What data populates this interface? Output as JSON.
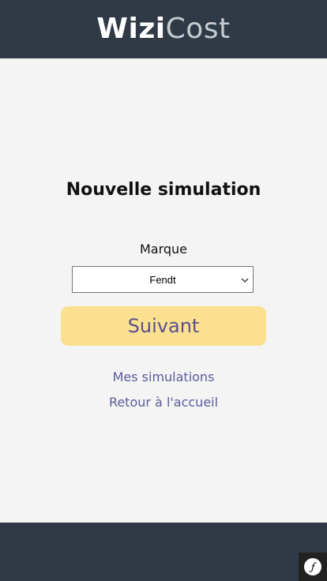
{
  "header": {
    "logo_part1": "Wizi",
    "logo_part2": "Cost"
  },
  "form": {
    "title": "Nouvelle simulation",
    "brand_label": "Marque",
    "brand_selected": "Fendt",
    "next_label": "Suivant"
  },
  "links": {
    "my_simulations": "Mes simulations",
    "back_home": "Retour à l'accueil"
  },
  "footer": {
    "debug_icon": "symfony-icon"
  },
  "colors": {
    "header_bg": "#2f3a46",
    "button_bg": "#fbe08f",
    "button_text": "#5a4f8f",
    "link_text": "#5a5c9a",
    "page_bg": "#f4f4f4"
  }
}
